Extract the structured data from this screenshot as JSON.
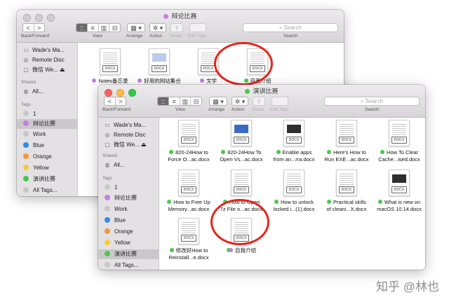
{
  "colors": {
    "purple": "#c77fe0",
    "green": "#4cc74a",
    "grey": "#c8c8c8",
    "blue": "#2f8be8",
    "orange": "#f19a38",
    "yellow": "#f5cd33",
    "red_annotation": "#e8231a"
  },
  "toolbar": {
    "back_forward_label": "Back/Forward",
    "view_label": "View",
    "arrange_label": "Arrange",
    "action_label": "Action",
    "share_label": "Share",
    "edit_tags_label": "Edit Tags",
    "search_label": "Search",
    "search_placeholder": "Search",
    "back_glyph": "<",
    "forward_glyph": ">",
    "view_icons": [
      "::",
      "≡",
      "▥",
      "⊟"
    ],
    "arrange_glyph": "▦ ▾",
    "action_glyph": "✲ ▾",
    "share_glyph": "⇪"
  },
  "back_window": {
    "title": "辩论比赛",
    "sidebar": {
      "favorites": [
        {
          "icon": "laptop-icon",
          "glyph": "▭",
          "label": "Wade's Ma..."
        },
        {
          "icon": "disc-icon",
          "glyph": "◎",
          "label": "Remote Disc"
        },
        {
          "icon": "drive-icon",
          "glyph": "▢",
          "label": "微信 We... ⏏"
        }
      ],
      "shared_header": "Shared",
      "shared": [
        {
          "icon": "network-icon",
          "glyph": "◍",
          "label": "All..."
        }
      ],
      "tags_header": "Tags",
      "tags": [
        {
          "color": "#c8c8c8",
          "label": "1"
        },
        {
          "color": "#c77fe0",
          "label": "辩论比赛",
          "selected": true
        },
        {
          "color": "#c8c8c8",
          "label": "Work"
        },
        {
          "color": "#2f8be8",
          "label": "Blue"
        },
        {
          "color": "#f19a38",
          "label": "Orange"
        },
        {
          "color": "#f5cd33",
          "label": "Yellow"
        },
        {
          "color": "#4cc74a",
          "label": "演讲比赛"
        },
        {
          "color": "#c8c8c8",
          "label": "All Tags..."
        }
      ]
    },
    "files": [
      {
        "tag": "DOCX",
        "name": "Notes备忘录",
        "color": "#c77fe0"
      },
      {
        "tag": "DOCX",
        "name": "好用的网站集合",
        "color": "#c77fe0"
      },
      {
        "tag": "DOCX",
        "name": "文学",
        "color": "#c77fe0"
      },
      {
        "tag": "DOCX",
        "name": "自我介绍",
        "color": "#4cc74a"
      }
    ]
  },
  "front_window": {
    "title": "演讲比赛",
    "sidebar": {
      "favorites": [
        {
          "icon": "laptop-icon",
          "glyph": "▭",
          "label": "Wade's Ma..."
        },
        {
          "icon": "disc-icon",
          "glyph": "◎",
          "label": "Remote Disc"
        },
        {
          "icon": "drive-icon",
          "glyph": "▢",
          "label": "微信 We... ⏏"
        }
      ],
      "shared_header": "Shared",
      "shared": [
        {
          "icon": "network-icon",
          "glyph": "◍",
          "label": "All..."
        }
      ],
      "tags_header": "Tags",
      "tags": [
        {
          "color": "#c8c8c8",
          "label": "1"
        },
        {
          "color": "#c77fe0",
          "label": "辩论比赛"
        },
        {
          "color": "#c8c8c8",
          "label": "Work"
        },
        {
          "color": "#2f8be8",
          "label": "Blue"
        },
        {
          "color": "#f19a38",
          "label": "Orange"
        },
        {
          "color": "#f5cd33",
          "label": "Yellow"
        },
        {
          "color": "#4cc74a",
          "label": "演讲比赛",
          "selected": true
        },
        {
          "color": "#c8c8c8",
          "label": "All Tags..."
        }
      ]
    },
    "files": [
      {
        "tag": "DOCX",
        "line1": "820-24How to",
        "line2": "Force O...ac.docx",
        "color": "#4cc74a",
        "preview": "text"
      },
      {
        "tag": "DOCX",
        "line1": "820-24How To",
        "line2": "Open Vs...ac.docx",
        "color": "#4cc74a",
        "preview": "blue"
      },
      {
        "tag": "DOCX",
        "line1": "Enable apps",
        "line2": "from an...rra.docx",
        "color": "#4cc74a",
        "preview": "dark"
      },
      {
        "tag": "DOCX",
        "line1": "Here's How to",
        "line2": "Run EXE...ac.docx",
        "color": "#4cc74a",
        "preview": "text"
      },
      {
        "tag": "DOCX",
        "line1": "How To Clear",
        "line2": "Cache...ised.docx",
        "color": "#4cc74a",
        "preview": "text"
      },
      {
        "tag": "DOCX",
        "line1": "How to Free Up",
        "line2": "Memory...ac.docx",
        "color": "#4cc74a",
        "preview": "text"
      },
      {
        "tag": "DOCX",
        "line1": "How to Open",
        "line2": "7z File o...ac.docx",
        "color": "#4cc74a",
        "preview": "text"
      },
      {
        "tag": "DOCX",
        "line1": "How to unlock",
        "line2": "locked i...(1).docx",
        "color": "#4cc74a",
        "preview": "text"
      },
      {
        "tag": "DOCX",
        "line1": "Practical skills",
        "line2": "of cleani...X.docx",
        "color": "#4cc74a",
        "preview": "text"
      },
      {
        "tag": "DOCX",
        "line1": "What is new on",
        "line2": "macOS 10.14.docx",
        "color": "#4cc74a",
        "preview": "dark"
      },
      {
        "tag": "DOCX",
        "line1": "修改好How to",
        "line2": "Reinstall...e.docx",
        "color": "#4cc74a",
        "preview": "text"
      },
      {
        "tag": "DOCX",
        "line1": "自我介绍",
        "line2": "",
        "color": "#4cc74a",
        "preview": "text",
        "extra_color": "#c77fe0"
      }
    ]
  },
  "watermark": "知乎 @林也"
}
